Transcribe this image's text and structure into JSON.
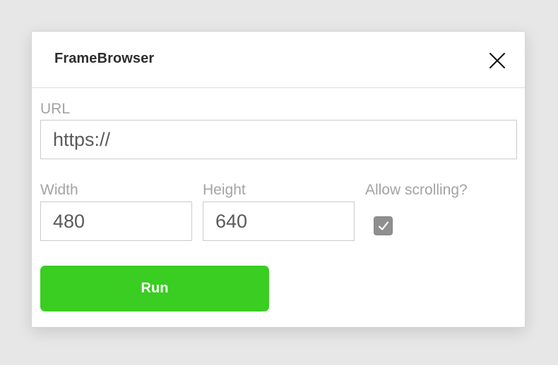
{
  "dialog": {
    "title": "FrameBrowser",
    "close_icon": "close-icon"
  },
  "form": {
    "url": {
      "label": "URL",
      "value": "https://"
    },
    "width": {
      "label": "Width",
      "value": "480"
    },
    "height": {
      "label": "Height",
      "value": "640"
    },
    "scrolling": {
      "label": "Allow scrolling?",
      "checked": true,
      "icon": "checkmark-icon"
    },
    "run_label": "Run"
  },
  "colors": {
    "background": "#e7e7e7",
    "dialog_background": "#ffffff",
    "run_button": "#3acd22",
    "checkbox_fill": "#8f8f8f",
    "label_text": "#a3a3a3"
  }
}
